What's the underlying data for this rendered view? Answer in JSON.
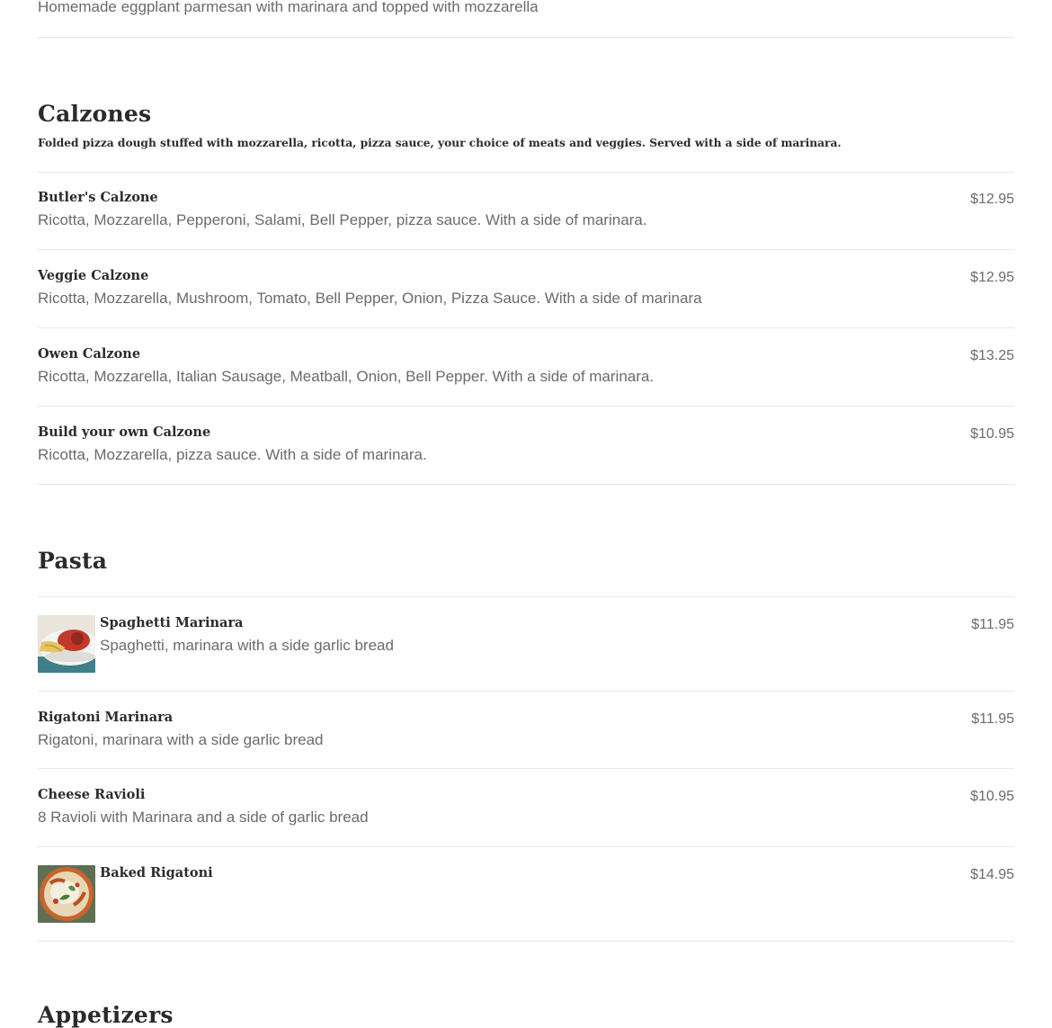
{
  "top_item": {
    "description": "Homemade eggplant parmesan with marinara and topped with mozzarella"
  },
  "calzones": {
    "title": "Calzones",
    "description": "Folded pizza dough stuffed with mozzarella, ricotta, pizza sauce, your choice of meats and veggies. Served with a side of marinara.",
    "items": [
      {
        "name": "Butler's Calzone",
        "description": "Ricotta, Mozzarella, Pepperoni, Salami, Bell Pepper, pizza sauce. With a side of marinara.",
        "price": "$12.95"
      },
      {
        "name": "Veggie Calzone",
        "description": "Ricotta, Mozzarella, Mushroom, Tomato, Bell Pepper, Onion, Pizza Sauce. With a side of marinara",
        "price": "$12.95"
      },
      {
        "name": "Owen Calzone",
        "description": "Ricotta, Mozzarella, Italian Sausage, Meatball, Onion, Bell Pepper. With a side of marinara.",
        "price": "$13.25"
      },
      {
        "name": "Build your own Calzone",
        "description": "Ricotta, Mozzarella, pizza sauce. With a side of marinara.",
        "price": "$10.95"
      }
    ]
  },
  "pasta": {
    "title": "Pasta",
    "items": [
      {
        "name": "Spaghetti Marinara",
        "description": "Spaghetti, marinara with a side garlic bread",
        "price": "$11.95",
        "image_icon": "spaghetti-photo"
      },
      {
        "name": "Rigatoni Marinara",
        "description": "Rigatoni, marinara with a side garlic bread",
        "price": "$11.95"
      },
      {
        "name": "Cheese Ravioli",
        "description": "8 Ravioli with Marinara and a side of garlic bread",
        "price": "$10.95"
      },
      {
        "name": "Baked Rigatoni",
        "price": "$14.95",
        "image_icon": "baked-rigatoni-photo"
      }
    ]
  },
  "appetizers": {
    "title": "Appetizers"
  }
}
